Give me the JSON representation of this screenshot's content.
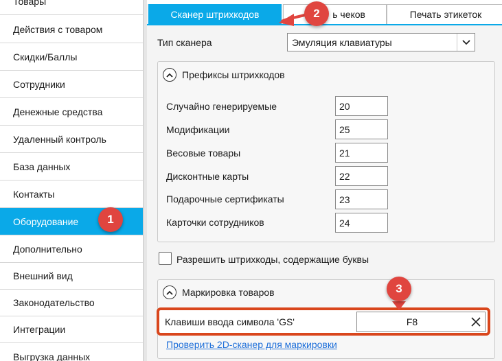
{
  "sidebar": {
    "items": [
      {
        "label": "Товары"
      },
      {
        "label": "Действия с товаром"
      },
      {
        "label": "Скидки/Баллы"
      },
      {
        "label": "Сотрудники"
      },
      {
        "label": "Денежные средства"
      },
      {
        "label": "Удаленный контроль"
      },
      {
        "label": "База данных"
      },
      {
        "label": "Контакты"
      },
      {
        "label": "Оборудование"
      },
      {
        "label": "Дополнительно"
      },
      {
        "label": "Внешний вид"
      },
      {
        "label": "Законодательство"
      },
      {
        "label": "Интеграции"
      },
      {
        "label": "Выгрузка данных"
      }
    ],
    "active_item": "Оборудование"
  },
  "tabs": [
    {
      "label": "Сканер штрихкодов",
      "active": true
    },
    {
      "label": "ь чеков",
      "active": false
    },
    {
      "label": "Печать этикеток",
      "active": false
    }
  ],
  "scanner": {
    "type_label": "Тип сканера",
    "type_value": "Эмуляция клавиатуры"
  },
  "prefixes": {
    "title": "Префиксы штрихкодов",
    "rows": [
      {
        "label": "Случайно генерируемые",
        "value": "20"
      },
      {
        "label": "Модификации",
        "value": "25"
      },
      {
        "label": "Весовые товары",
        "value": "21"
      },
      {
        "label": "Дисконтные карты",
        "value": "22"
      },
      {
        "label": "Подарочные сертификаты",
        "value": "23"
      },
      {
        "label": "Карточки сотрудников",
        "value": "24"
      }
    ]
  },
  "allow_letters": {
    "label": "Разрешить штрихкоды, содержащие буквы",
    "checked": false
  },
  "marking": {
    "title": "Маркировка товаров",
    "gs_label": "Клавиши ввода символа 'GS'",
    "gs_value": "F8",
    "check_link": "Проверить 2D-сканер для маркировки"
  },
  "annotations": {
    "badge_1": "1",
    "badge_2": "2",
    "badge_3": "3"
  },
  "colors": {
    "accent": "#0aa9e8",
    "callout": "#e0453f",
    "highlight": "#d9461c",
    "link": "#1e6fd9"
  },
  "icons": {
    "select_arrow": "chevron-down-icon",
    "collapse": "chevron-up-icon",
    "clear": "close-icon"
  }
}
